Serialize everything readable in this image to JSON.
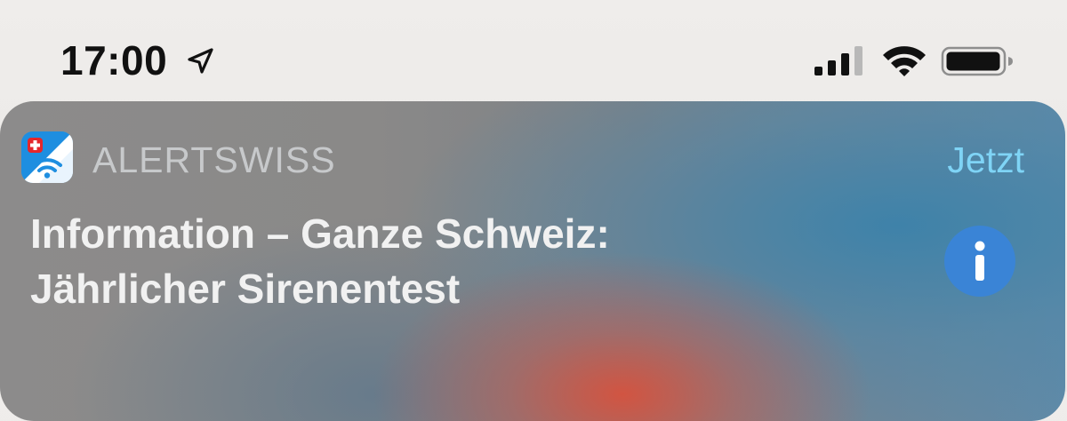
{
  "status_bar": {
    "time": "17:00",
    "icons": [
      "location-arrow-icon",
      "cellular-signal-icon",
      "wifi-icon",
      "battery-icon"
    ]
  },
  "notification": {
    "app_icon": "alertswiss-app-icon",
    "app_name": "ALERTSWISS",
    "timestamp": "Jetzt",
    "message_line_1": "Information – Ganze Schweiz:",
    "message_line_2": "Jährlicher Sirenentest",
    "action_icon": "info-icon"
  },
  "colors": {
    "timestamp": "#7fd4f6",
    "info_button": "#3a84d6",
    "app_icon_blue": "#2e9fe8",
    "swiss_red": "#e5262b"
  }
}
